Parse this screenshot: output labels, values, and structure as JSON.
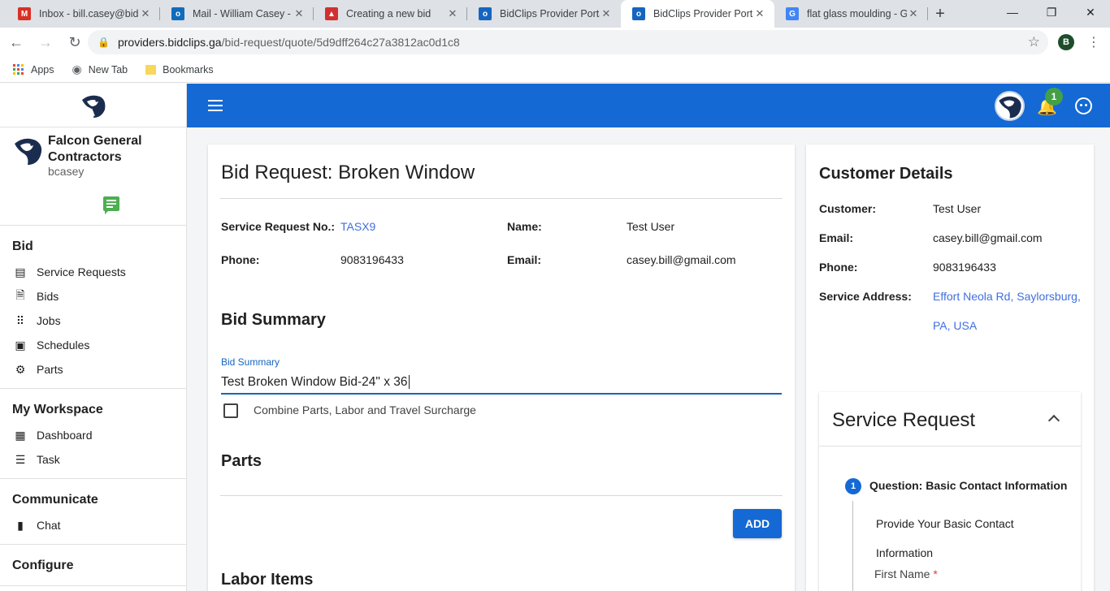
{
  "browser": {
    "tabs": [
      {
        "title": "Inbox - bill.casey@bidc",
        "icon": "gmail-icon",
        "color": "#d93025",
        "glyph": "M"
      },
      {
        "title": "Mail - William Casey - C",
        "icon": "outlook-icon",
        "color": "#0f6cbd",
        "glyph": "o"
      },
      {
        "title": "Creating a new bid",
        "icon": "triangle-icon",
        "color": "#d32f2f",
        "glyph": "▲"
      },
      {
        "title": "BidClips Provider Portal",
        "icon": "bidclips-icon",
        "color": "#1565c0",
        "glyph": "o"
      },
      {
        "title": "BidClips Provider Portal",
        "icon": "bidclips-icon",
        "color": "#1565c0",
        "glyph": "o"
      },
      {
        "title": "flat glass moulding - Go",
        "icon": "google-icon",
        "color": "#4285f4",
        "glyph": "G"
      }
    ],
    "active_tab": 4,
    "url_host": "providers.bidclips.ga",
    "url_path": "/bid-request/quote/5d9dff264c27a3812ac0d1c8",
    "profile_initial": "B",
    "bookmarks": [
      {
        "label": "Apps",
        "icon": "apps-grid-icon"
      },
      {
        "label": "New Tab",
        "icon": "globe-icon"
      },
      {
        "label": "Bookmarks",
        "icon": "folder-icon"
      }
    ]
  },
  "header": {
    "notification_count": "1"
  },
  "sidebar": {
    "org_name": "Falcon General Contractors",
    "username": "bcasey",
    "sections": [
      {
        "title": "Bid",
        "items": [
          {
            "label": "Service Requests",
            "icon": "service-requests-icon"
          },
          {
            "label": "Bids",
            "icon": "document-icon"
          },
          {
            "label": "Jobs",
            "icon": "grid-icon"
          },
          {
            "label": "Schedules",
            "icon": "contact-icon"
          },
          {
            "label": "Parts",
            "icon": "gear-icon"
          }
        ]
      },
      {
        "title": "My Workspace",
        "items": [
          {
            "label": "Dashboard",
            "icon": "dashboard-icon"
          },
          {
            "label": "Task",
            "icon": "list-icon"
          }
        ]
      },
      {
        "title": "Communicate",
        "items": [
          {
            "label": "Chat",
            "icon": "chat-icon"
          }
        ]
      },
      {
        "title": "Configure",
        "items": []
      }
    ]
  },
  "bid_request": {
    "title": "Bid Request: Broken Window",
    "fields": {
      "service_request_no_label": "Service Request No.:",
      "service_request_no": "TASX9",
      "name_label": "Name:",
      "name": "Test User",
      "phone_label": "Phone:",
      "phone": "9083196433",
      "email_label": "Email:",
      "email": "casey.bill@gmail.com"
    },
    "bid_summary_heading": "Bid Summary",
    "bid_summary_field_label": "Bid Summary",
    "bid_summary_value": "Test Broken Window Bid-24\" x 36",
    "combine_label": "Combine Parts, Labor and Travel Surcharge",
    "parts_heading": "Parts",
    "add_label": "ADD",
    "labor_heading": "Labor Items"
  },
  "customer": {
    "heading": "Customer Details",
    "customer_label": "Customer:",
    "customer": "Test User",
    "email_label": "Email:",
    "email": "casey.bill@gmail.com",
    "phone_label": "Phone:",
    "phone": "9083196433",
    "address_label": "Service Address:",
    "address_line1": "Effort Neola Rd, Saylorsburg,",
    "address_line2": "PA, USA"
  },
  "service_request": {
    "heading": "Service Request",
    "step_number": "1",
    "step_title": "Question: Basic Contact Information",
    "step_desc": "Provide Your Basic Contact Information",
    "first_name_label": "First Name",
    "required_mark": "*"
  }
}
